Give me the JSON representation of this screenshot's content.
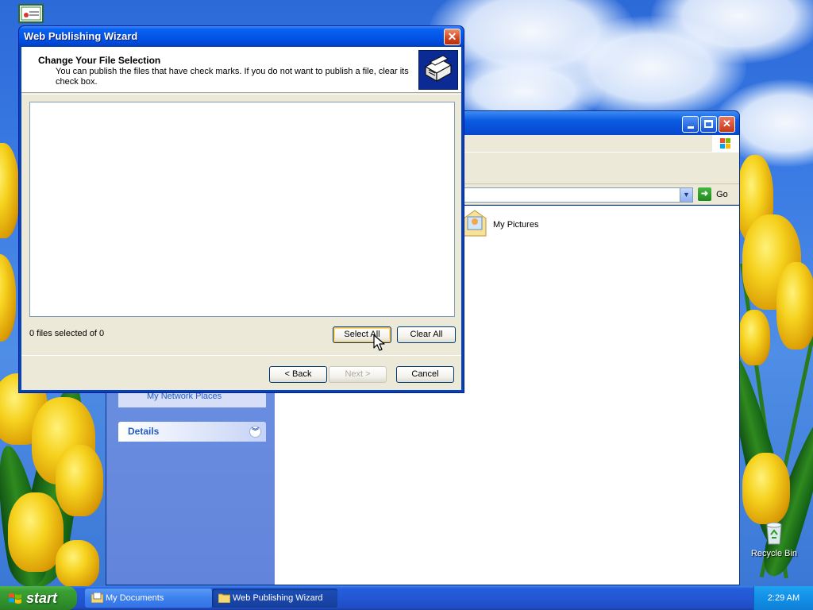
{
  "wizard": {
    "title": "Web Publishing Wizard",
    "header_title": "Change Your File Selection",
    "header_desc": "You can publish the files that have check marks.  If you do not want to publish a file, clear its check box.",
    "count_text": "0 files selected of 0",
    "select_all": "Select All",
    "clear_all": "Clear All",
    "back": "< Back",
    "next": "Next >",
    "cancel": "Cancel",
    "close_glyph": "✕"
  },
  "explorer": {
    "go_label": "Go",
    "folder_item": "My Pictures",
    "other_places_item": "My Network Places",
    "details_header": "Details"
  },
  "desktop": {
    "recycle_bin": "Recycle Bin"
  },
  "taskbar": {
    "start_label": "start",
    "tasks": [
      {
        "label": "My Documents",
        "icon": "my-documents-icon"
      },
      {
        "label": "Web Publishing Wizard",
        "icon": "folder-icon"
      }
    ],
    "clock": "2:29 AM"
  },
  "colors": {
    "titlebar_blue": "#0356e8",
    "start_green": "#3aa033",
    "taskbar_blue": "#245edb",
    "dialog_face": "#ece9d8",
    "task_pane_blue": "#6a8fe0"
  }
}
